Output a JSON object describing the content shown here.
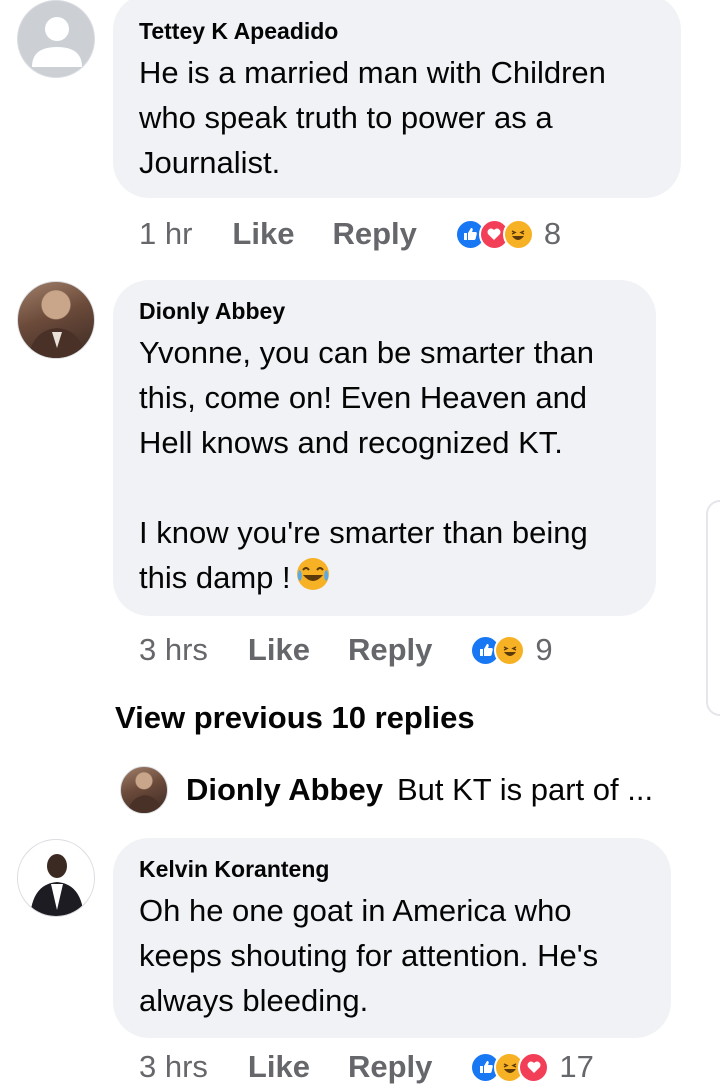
{
  "comments": [
    {
      "author": "Tettey K Apeadido",
      "text": "He is a married man with Children\nwho speak truth to power as a\nJournalist.",
      "time": "1 hr",
      "like_label": "Like",
      "reply_label": "Reply",
      "reactions": [
        "like",
        "love",
        "haha"
      ],
      "reaction_count": "8"
    },
    {
      "author": "Dionly Abbey",
      "text": "Yvonne, you can be smarter than\nthis, come on! Even Heaven and\nHell knows and recognized KT.\n\nI know you're smarter than being\nthis damp !",
      "time": "3 hrs",
      "like_label": "Like",
      "reply_label": "Reply",
      "reactions": [
        "like",
        "haha"
      ],
      "reaction_count": "9"
    },
    {
      "author": "Kelvin Koranteng",
      "text": "Oh he one goat in America who\nkeeps shouting for attention. He's\nalways bleeding.",
      "time": "3 hrs",
      "like_label": "Like",
      "reply_label": "Reply",
      "reactions": [
        "like",
        "haha",
        "love"
      ],
      "reaction_count": "17"
    }
  ],
  "view_previous_label": "View previous 10 replies",
  "reply_preview": {
    "author": "Dionly Abbey",
    "text": "But KT is part of ..."
  },
  "colors": {
    "like": "#1877f2",
    "love": "#f33e58",
    "haha": "#f7b125",
    "bubble": "#f0f2f5",
    "meta": "#65676b"
  }
}
